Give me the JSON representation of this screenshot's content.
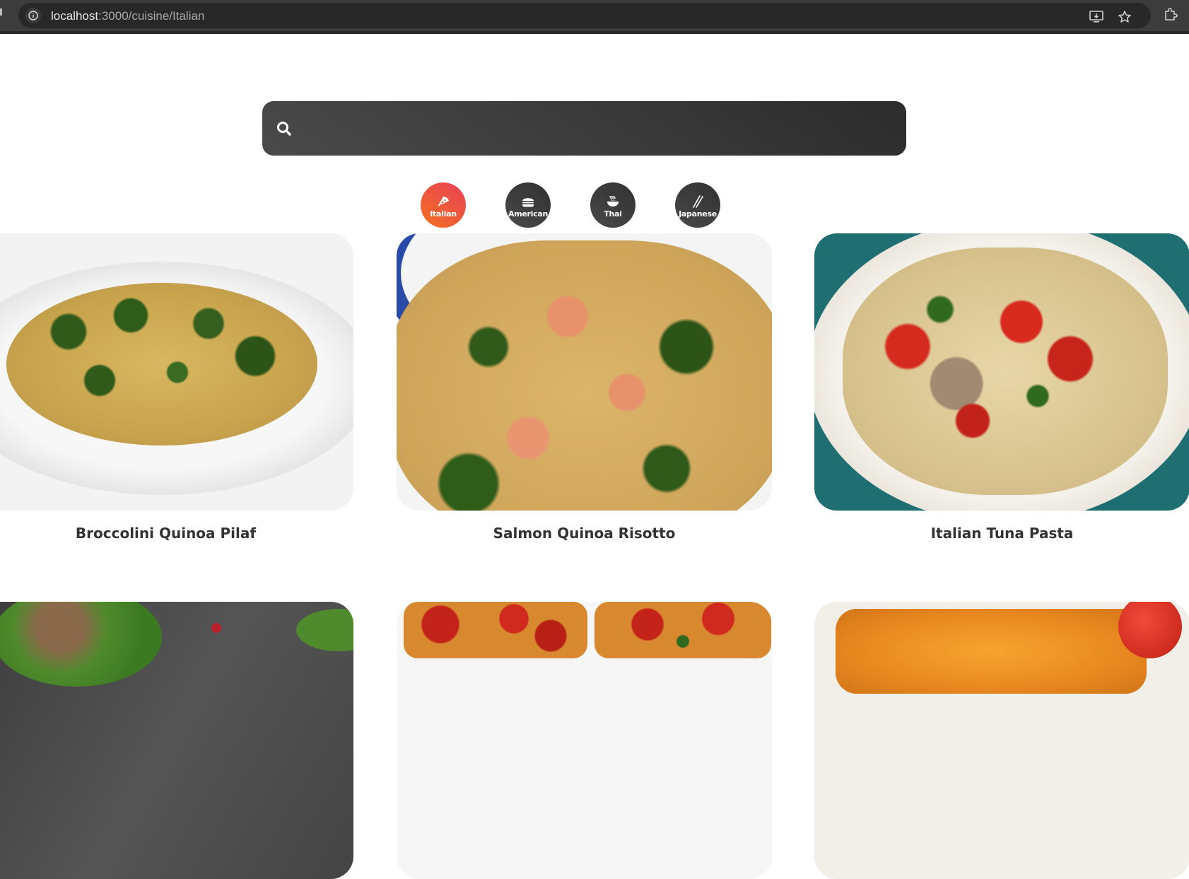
{
  "browser": {
    "url_host": "localhost",
    "url_path": ":3000/cuisine/Italian"
  },
  "search": {
    "value": "",
    "placeholder": ""
  },
  "cuisines": [
    {
      "label": "Italian",
      "icon": "pizza-icon",
      "active": true
    },
    {
      "label": "American",
      "icon": "hamburger-icon",
      "active": false
    },
    {
      "label": "Thai",
      "icon": "noodle-bowl-icon",
      "active": false
    },
    {
      "label": "Japanese",
      "icon": "chopsticks-icon",
      "active": false
    }
  ],
  "recipes": [
    {
      "title": "Broccolini Quinoa Pilaf"
    },
    {
      "title": "Salmon Quinoa Risotto"
    },
    {
      "title": "Italian Tuna Pasta"
    },
    {
      "title": ""
    },
    {
      "title": ""
    },
    {
      "title": ""
    }
  ],
  "colors": {
    "accent_start": "#f27121",
    "accent_end": "#e94057",
    "chip_dark": "#313131",
    "title_text": "#333333"
  }
}
